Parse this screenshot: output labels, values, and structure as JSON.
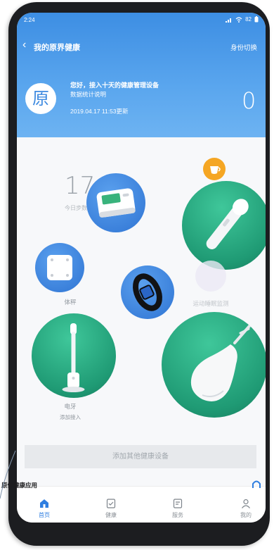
{
  "status_bar": {
    "time": "2:24",
    "battery": "82"
  },
  "header": {
    "back_icon": "back-arrow-icon",
    "title": "我的原界健康",
    "action": "身份切换"
  },
  "profile": {
    "avatar_char": "原",
    "line1": "您好，接入十天的健康管理设备",
    "line2": "数据统计说明",
    "updated": "2019.04.17 11:53更新",
    "count": "0"
  },
  "steps": {
    "value": "17",
    "label": "今日步数"
  },
  "devices": {
    "body_scale": "体秤",
    "sleep_monitor": "运动睡眠监测",
    "toothbrush": "电牙",
    "toothbrush_sub": "添加接入"
  },
  "add_bar": "添加其他健康设备",
  "tabs": [
    {
      "label": "首页",
      "icon": "home-icon",
      "active": true
    },
    {
      "label": "健康",
      "icon": "health-doc-icon",
      "active": false
    },
    {
      "label": "服务",
      "icon": "service-doc-icon",
      "active": false
    },
    {
      "label": "我的",
      "icon": "profile-icon",
      "active": false
    }
  ],
  "overlay_caption": "原体健康应用",
  "colors": {
    "header_blue": "#4b9ae6",
    "device_blue": "#3b82dd",
    "device_green": "#27a880",
    "accent_orange": "#f5a623",
    "tab_active": "#2f7ee0"
  }
}
